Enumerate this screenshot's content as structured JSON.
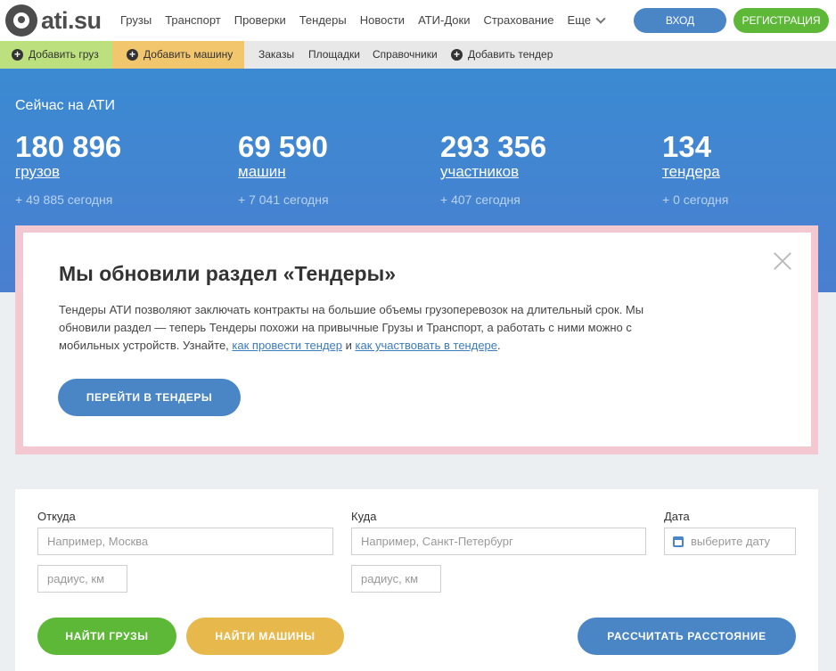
{
  "header": {
    "logo_text": "ati.su",
    "nav": [
      "Грузы",
      "Транспорт",
      "Проверки",
      "Тендеры",
      "Новости",
      "АТИ-Доки",
      "Страхование"
    ],
    "more_label": "Еще",
    "login_label": "ВХОД",
    "register_label": "РЕГИСТРАЦИЯ"
  },
  "subbar": {
    "add_cargo": "Добавить груз",
    "add_truck": "Добавить машину",
    "orders": "Заказы",
    "platforms": "Площадки",
    "references": "Справочники",
    "add_tender": "Добавить тендер"
  },
  "hero": {
    "title": "Сейчас на АТИ",
    "stats": [
      {
        "value": "180 896",
        "label": "грузов",
        "today": "+ 49 885 сегодня"
      },
      {
        "value": "69 590",
        "label": "машин",
        "today": "+ 7 041 сегодня"
      },
      {
        "value": "293 356",
        "label": "участников",
        "today": "+ 407 сегодня"
      },
      {
        "value": "134",
        "label": "тендера",
        "today": "+ 0 сегодня"
      }
    ]
  },
  "modal": {
    "title": "Мы обновили раздел «Тендеры»",
    "text_before": "Тендеры АТИ позволяют заключать контракты на большие объемы грузоперевозок на длительный срок. Мы обновили раздел — теперь Тендеры похожи на привычные Грузы и Транспорт, а работать с ними можно с мобильных устройств. Узнайте, ",
    "link1": "как провести тендер",
    "text_between": " и ",
    "link2": "как участвовать в тендере",
    "text_after": ".",
    "button": "ПЕРЕЙТИ В ТЕНДЕРЫ"
  },
  "search": {
    "from_label": "Откуда",
    "from_placeholder": "Например, Москва",
    "to_label": "Куда",
    "to_placeholder": "Например, Санкт-Петербург",
    "date_label": "Дата",
    "date_placeholder": "выберите дату",
    "radius_placeholder": "радиус, км",
    "find_cargo": "НАЙТИ ГРУЗЫ",
    "find_trucks": "НАЙТИ МАШИНЫ",
    "calc_distance": "РАССЧИТАТЬ РАССТОЯНИЕ"
  }
}
